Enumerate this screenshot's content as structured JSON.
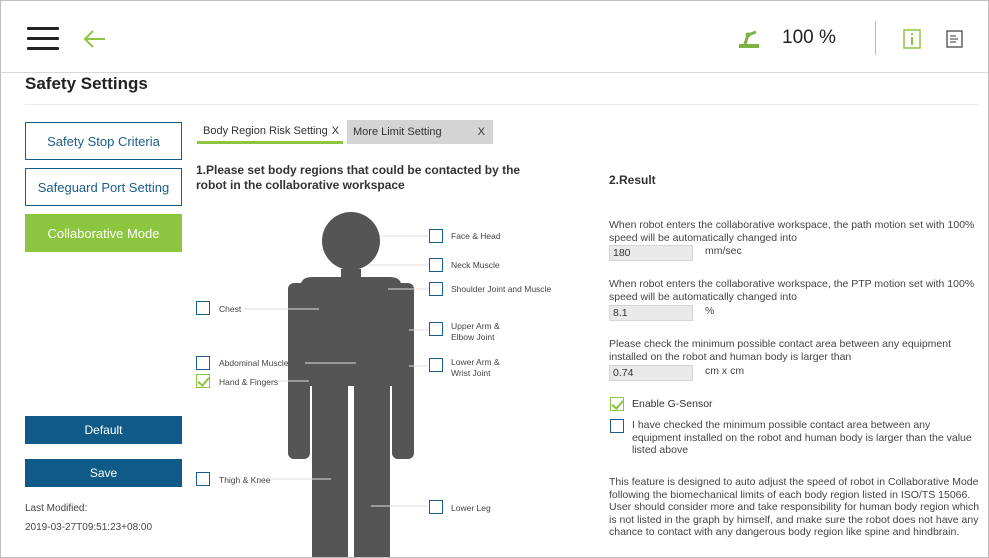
{
  "topbar": {
    "menu_icon": "hamburger-menu-icon",
    "back_icon": "back-arrow-icon",
    "robot_icon": "robot-arm-icon",
    "speed": "100 %",
    "info_icon": "info-icon",
    "doc_icon": "document-icon",
    "accent_color": "#8cc63f"
  },
  "page": {
    "title": "Safety Settings"
  },
  "nav": {
    "items": [
      {
        "label": "Safety Stop Criteria",
        "active": false
      },
      {
        "label": "Safeguard Port Setting",
        "active": false
      },
      {
        "label": "Collaborative Mode",
        "active": true
      }
    ],
    "default_label": "Default",
    "save_label": "Save",
    "last_modified_label": "Last Modified:",
    "last_modified_value": "2019-03-27T09:51:23+08:00",
    "primary_color": "#0f5a87"
  },
  "tabs": [
    {
      "label": "Body Region Risk Setting",
      "close": "X",
      "active": true
    },
    {
      "label": "More Limit Setting",
      "close": "X",
      "active": false
    }
  ],
  "section1": {
    "title": "1.Please set body regions that could be contacted by the robot in the collaborative workspace",
    "regions": [
      {
        "label": "Face & Head",
        "checked": false
      },
      {
        "label": "Neck Muscle",
        "checked": false
      },
      {
        "label": "Shoulder Joint and Muscle",
        "checked": false
      },
      {
        "label": "Chest",
        "checked": false
      },
      {
        "label": "Upper Arm &\nElbow Joint",
        "checked": false
      },
      {
        "label": "Abdominal Muscle",
        "checked": false
      },
      {
        "label": "Lower Arm &\nWrist Joint",
        "checked": false
      },
      {
        "label": "Hand & Fingers",
        "checked": true
      },
      {
        "label": "Thigh & Knee",
        "checked": false
      },
      {
        "label": "Lower Leg",
        "checked": false
      }
    ]
  },
  "section2": {
    "title": "2.Result",
    "path_text": "When robot enters the collaborative workspace, the path motion set with 100% speed will be automatically changed into",
    "path_value": "180",
    "path_unit": "mm/sec",
    "ptp_text": "When robot enters the collaborative workspace, the PTP motion set with 100% speed will be automatically changed into",
    "ptp_value": "8.1",
    "ptp_unit": "%",
    "area_text": "Please check the minimum possible contact area between any equipment installed on the robot and human body is larger than",
    "area_value": "0.74",
    "area_unit": "cm x cm",
    "gsensor_label": "Enable G-Sensor",
    "gsensor_checked": true,
    "confirm_label": "I have checked the minimum possible contact area between any equipment installed on the robot and human body is larger than the value listed above",
    "confirm_checked": false,
    "note": "This feature is designed to auto adjust the speed of robot in Collaborative Mode following the biomechanical limits of each body region listed in ISO/TS 15066. User should consider more and take responsibility for human body region which is not listed in the graph by himself, and make sure the robot does not have any chance to contact with any dangerous body region like spine and hindbrain."
  }
}
